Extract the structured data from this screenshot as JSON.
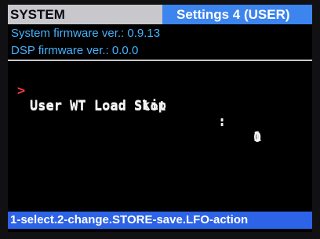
{
  "header": {
    "section": "SYSTEM",
    "page": "Settings 4 (USER)"
  },
  "info": {
    "system_firmware": "System firmware ver.: 0.9.13",
    "dsp_firmware": "DSP firmware ver.: 0.0.0"
  },
  "cursor_symbol": ">",
  "params": [
    {
      "name": "User WT Load Slot",
      "separator": ":",
      "value": "0",
      "selected": true
    },
    {
      "name": "User WT Load Skip",
      "separator": ":",
      "value": "1",
      "selected": false
    }
  ],
  "footer": {
    "hint": "1-select.2-change.STORE-save.LFO-action"
  },
  "colors": {
    "header_left_bg": "#c8c8cc",
    "header_right_bg": "#3c84ee",
    "info_text": "#46b2ff",
    "cursor": "#ff3a3a",
    "param_text": "#f2f2f2",
    "footer_bg": "#2d63e6",
    "screen_bg": "#000000"
  }
}
